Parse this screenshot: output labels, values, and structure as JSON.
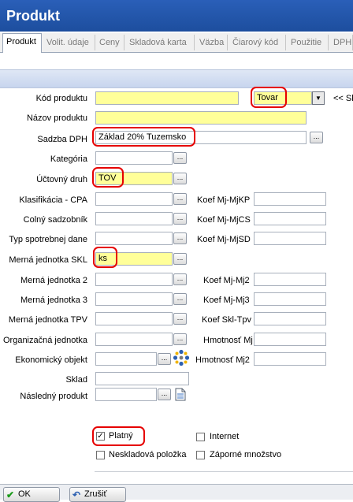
{
  "window": {
    "title": "Produkt"
  },
  "tabs": [
    "Produkt",
    "Volit. údaje",
    "Ceny",
    "Skladová karta",
    "Väzba",
    "Čiarový kód",
    "Použitie",
    "DPH"
  ],
  "form": {
    "kod_produktu": {
      "label": "Kód produktu",
      "value": "",
      "typ": "Tovar",
      "suffix": "<< Sk"
    },
    "nazov": {
      "label": "Názov produktu",
      "value": ""
    },
    "sadzba": {
      "label": "Sadzba DPH",
      "value": "Základ 20% Tuzemsko"
    },
    "kategoria": {
      "label": "Kategória",
      "value": ""
    },
    "uctovny": {
      "label": "Účtovný druh",
      "value": "TOV"
    },
    "cpa": {
      "label": "Klasifikácia - CPA",
      "value": "",
      "koef_label": "Koef Mj-MjKP"
    },
    "colny": {
      "label": "Colný sadzobník",
      "value": "",
      "koef_label": "Koef Mj-MjCS"
    },
    "spotreba": {
      "label": "Typ spotrebnej dane",
      "value": "",
      "koef_label": "Koef Mj-MjSD"
    },
    "mj_skl": {
      "label": "Merná jednotka SKL",
      "value": "ks"
    },
    "mj2": {
      "label": "Merná jednotka 2",
      "value": "",
      "koef_label": "Koef Mj-Mj2"
    },
    "mj3": {
      "label": "Merná jednotka 3",
      "value": "",
      "koef_label": "Koef Mj-Mj3"
    },
    "mj_tpv": {
      "label": "Merná jednotka TPV",
      "value": "",
      "koef_label": "Koef Skl-Tpv"
    },
    "org": {
      "label": "Organizačná jednotka",
      "value": "",
      "koef_label": "Hmotnosť Mj"
    },
    "ekon": {
      "label": "Ekonomický objekt",
      "value": "",
      "koef_label": "Hmotnosť Mj2"
    },
    "sklad": {
      "label": "Sklad",
      "value": ""
    },
    "nasledny": {
      "label": "Následný produkt",
      "value": ""
    }
  },
  "checkboxes": {
    "platny": {
      "label": "Platný",
      "checked": true
    },
    "internet": {
      "label": "Internet",
      "checked": false
    },
    "neskladova": {
      "label": "Neskladová položka",
      "checked": false
    },
    "zaporne": {
      "label": "Záporné množstvo",
      "checked": false
    }
  },
  "buttons": {
    "ok": "OK",
    "zrusit": "Zrušiť",
    "browse": "..."
  },
  "icons": {
    "check": "✓",
    "checkmark_ok": "✔",
    "undo": "↶",
    "dropdown": "▼"
  },
  "colors": {
    "title_bar": "#1d4e9e",
    "required_field": "#ffff99",
    "highlight": "#e60000"
  }
}
